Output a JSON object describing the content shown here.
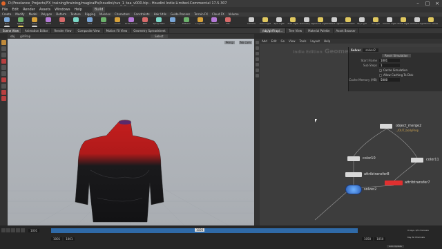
{
  "window": {
    "title": "D:/Freelance_Projects/FX_training/training/magicalFx/houdini/nvs_1_tea_v000.hip - Houdini Indie Limited-Commercial 17.5.307"
  },
  "menu": [
    "File",
    "Edit",
    "Render",
    "Assets",
    "Windows",
    "Help",
    "Build"
  ],
  "shelf_tabs": [
    "Create",
    "Modify",
    "Model",
    "Polygon",
    "Deform",
    "Texture",
    "Rigging",
    "Muscles",
    "Characters",
    "Constraints",
    "Hair Utils",
    "Guide Process",
    "Terrain FX",
    "Cloud FX",
    "Volume"
  ],
  "shelf_tools": [
    "Box",
    "Sphere",
    "Tube",
    "Torus",
    "Grid",
    "Null",
    "Line",
    "Circle",
    "Curve",
    "Draw Curve",
    "Path",
    "Spray Paint",
    "Font",
    "Platonic",
    "L-System",
    "Metaball",
    "File"
  ],
  "light_tools": [
    "Camera",
    "Point Light",
    "Spot Light",
    "Area Light",
    "Geometry Light",
    "Volume Light",
    "Distant Light",
    "Environment",
    "Sky Light",
    "GI Light",
    "Caustic Light",
    "Portal Light",
    "Ambient Light",
    "Stereo Camera",
    "VR Camera",
    "Switcher",
    "Gamepad"
  ],
  "left_panel": {
    "tabs": [
      "Scene View",
      "Animation Editor",
      "Render View",
      "Composite View",
      "Motion FX View",
      "Geometry Spreadsheet"
    ],
    "path": "obj",
    "node": "girlFrap",
    "viewport_menu": "Select",
    "viewport_cam": "No cam",
    "persp": "Persp"
  },
  "right_panel": {
    "tabs": [
      "/obj/girlFrap/...",
      "Tree View",
      "Material Palette",
      "Asset Browser"
    ],
    "path": "obj",
    "node": "girlFrap",
    "menu": [
      "Add",
      "Edit",
      "Go",
      "View",
      "Tools",
      "Layout",
      "Help"
    ],
    "context_label": "Indie Edition",
    "context_type": "Geometry"
  },
  "parm": {
    "type": "Solver",
    "name": "solver2",
    "reset_button": "Reset Simulation",
    "rows": [
      {
        "label": "Start Frame",
        "value": "1001"
      },
      {
        "label": "Sub Steps",
        "value": "1"
      }
    ],
    "toggles": [
      {
        "label": "Cache Simulation",
        "checked": true
      },
      {
        "label": "Allow Caching To Disk",
        "checked": false
      }
    ],
    "cache_label": "Cache Memory (MB)",
    "cache_value": "5000"
  },
  "nodes": [
    {
      "label": "object_merge2",
      "sub": "../OUT_bodyPrep",
      "color": "#d8d8d8"
    },
    {
      "label": "color10",
      "color": "#d8d8d8"
    },
    {
      "label": "color11",
      "color": "#d8d8d8"
    },
    {
      "label": "attribtransfer8",
      "color": "#d8d8d8"
    },
    {
      "label": "attribtransfer7",
      "color": "#e03030"
    },
    {
      "label": "solver2",
      "color": "#3f7fd8"
    }
  ],
  "timeline": {
    "start": "1001",
    "end": "1050",
    "current": "1001",
    "range_start": "1001",
    "range_end": "1050",
    "frame_marker": "1026",
    "keys_label": "0 keys, 0/0 channels",
    "key_all_channels": "Key All Channels",
    "auto_update": "Auto Update"
  },
  "colors": {
    "accent_red": "#c41e1e",
    "shirt_black": "#141416",
    "node_blue": "#3f7fd8",
    "timeline_blue": "#2f6aa8"
  }
}
